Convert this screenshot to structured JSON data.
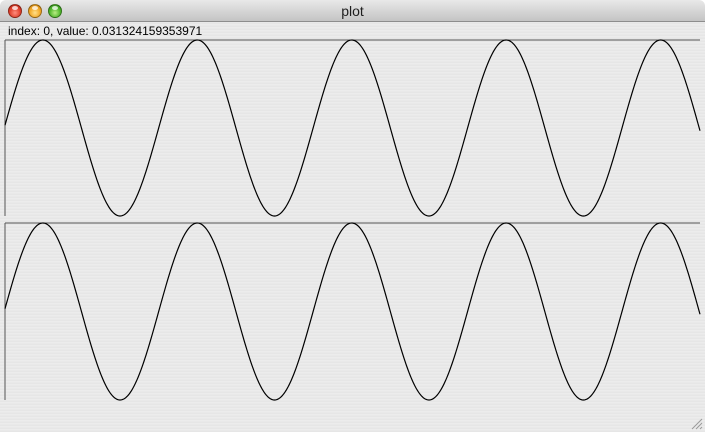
{
  "window": {
    "title": "plot"
  },
  "status": {
    "text": "index: 0, value: 0.031324159353971"
  },
  "icons": {
    "close": "close-icon",
    "minimize": "minimize-icon",
    "maximize": "maximize-icon",
    "resize": "resize-grip-icon"
  },
  "chart_data": [
    {
      "type": "line",
      "name": "",
      "cycles": 4.5,
      "function": "sine",
      "ylim": [
        -1,
        1
      ],
      "x_samples": 695,
      "series": [
        {
          "values_shape": "sine",
          "color": "#000000"
        }
      ]
    },
    {
      "type": "line",
      "name": "",
      "cycles": 4.5,
      "function": "sine",
      "ylim": [
        -1,
        1
      ],
      "x_samples": 695,
      "series": [
        {
          "values_shape": "sine",
          "color": "#000000"
        }
      ]
    }
  ]
}
